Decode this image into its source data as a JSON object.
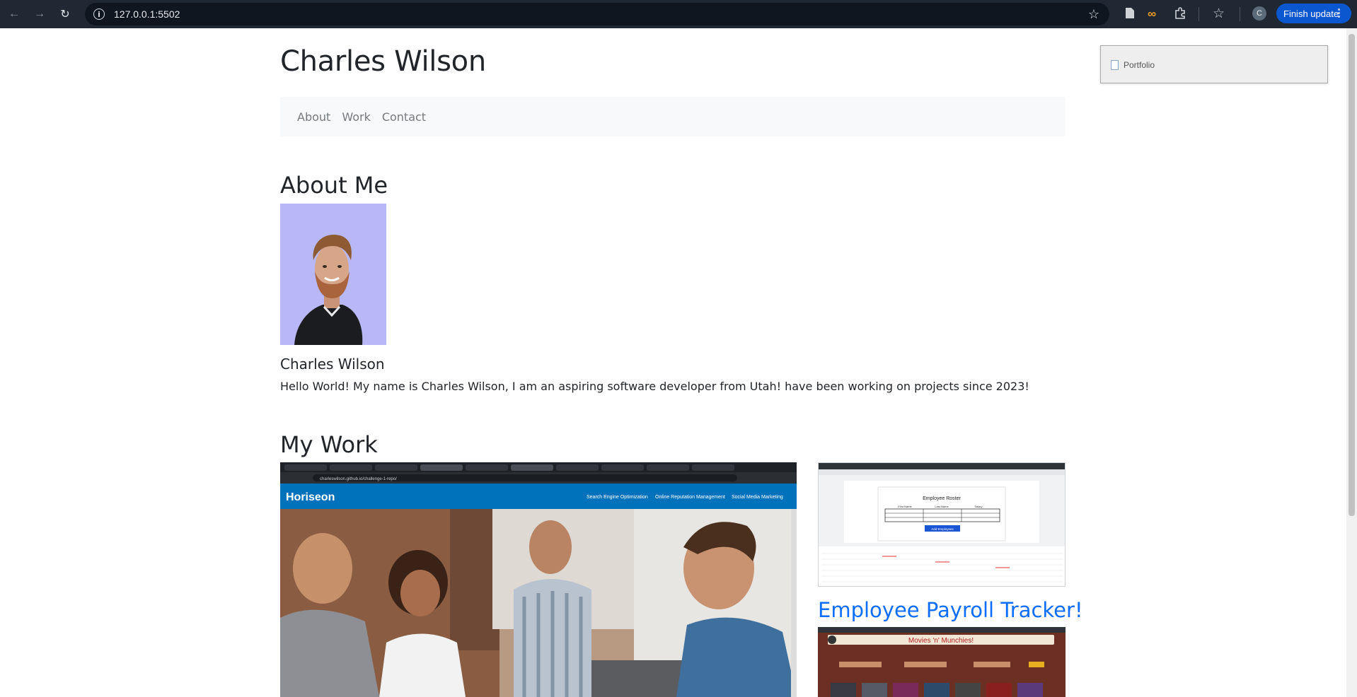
{
  "browser": {
    "url": "127.0.0.1:5502",
    "finish_update_label": "Finish update",
    "avatar_letter": "C",
    "icons": [
      "back-icon",
      "forward-icon",
      "reload-icon",
      "info-icon",
      "bookmark-star-icon",
      "document-extension-icon",
      "infinity-extension-icon",
      "puzzle-extensions-icon",
      "favorites-icon",
      "menu-dots-icon"
    ]
  },
  "popup": {
    "label": "Portfolio"
  },
  "header": {
    "title": "Charles Wilson"
  },
  "nav": {
    "items": [
      "About",
      "Work",
      "Contact"
    ]
  },
  "about": {
    "heading": "About Me",
    "name": "Charles Wilson",
    "bio": "Hello World! My name is Charles Wilson, I am an aspiring software developer from Utah! have been working on projects since 2023!",
    "photo_bg": "#b7b8f5"
  },
  "work": {
    "heading": "My Work",
    "main_shot": {
      "brand": "Horiseon",
      "url": "charleswilson.github.io/challenge-1-repo/",
      "nav": [
        "Search Engine Optimization",
        "Online Reputation Management",
        "Social Media Marketing"
      ]
    },
    "payroll_shot": {
      "title": "Employee Roster",
      "columns": [
        "First Name",
        "Last Name",
        "Salary"
      ],
      "button": "Add Employees"
    },
    "payroll_link": "Employee Payroll Tracker!",
    "movies_shot": {
      "title": "Movies 'n' Munchies!"
    }
  },
  "colors": {
    "link": "#0d6efd",
    "text": "#212529",
    "navbar_bg": "#f8f9fa",
    "chrome": "#1f2833",
    "update_button": "#0b57d0"
  }
}
